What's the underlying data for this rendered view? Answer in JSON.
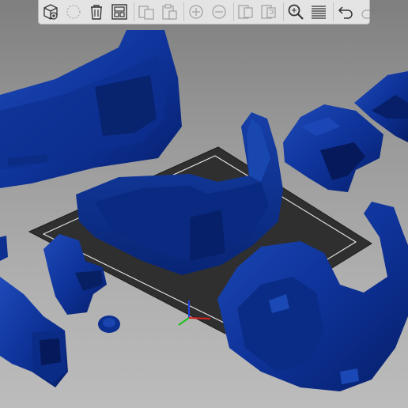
{
  "toolbar": {
    "buttons": [
      {
        "name": "add-object",
        "icon": "cube-add-icon",
        "enabled": true
      },
      {
        "name": "delete",
        "icon": "delete-dashed-icon",
        "enabled": false
      },
      {
        "name": "delete-all",
        "icon": "trash-icon",
        "enabled": true
      },
      {
        "name": "arrange",
        "icon": "arrange-grid-icon",
        "enabled": true
      },
      {
        "name": "copy",
        "icon": "copy-icon",
        "enabled": false
      },
      {
        "name": "paste",
        "icon": "paste-icon",
        "enabled": false
      },
      {
        "name": "add-instance",
        "icon": "plus-circle-icon",
        "enabled": false
      },
      {
        "name": "remove-instance",
        "icon": "minus-circle-icon",
        "enabled": false
      },
      {
        "name": "split-objects",
        "icon": "split-objects-icon",
        "enabled": false
      },
      {
        "name": "split-parts",
        "icon": "split-parts-icon",
        "enabled": false
      },
      {
        "name": "search",
        "icon": "search-icon",
        "enabled": true
      },
      {
        "name": "layers-editing",
        "icon": "layers-icon",
        "enabled": true
      },
      {
        "name": "undo",
        "icon": "undo-icon",
        "enabled": true
      },
      {
        "name": "redo",
        "icon": "redo-icon",
        "enabled": false
      }
    ]
  },
  "viewport": {
    "background_top": "#7f7f7f",
    "background_bottom": "#bcbcbc",
    "model_color": "#0b2f8e",
    "bed_color": "#2e2e2e",
    "axis_colors": {
      "x": "#d42020",
      "y": "#20c020",
      "z": "#2040e0"
    }
  }
}
